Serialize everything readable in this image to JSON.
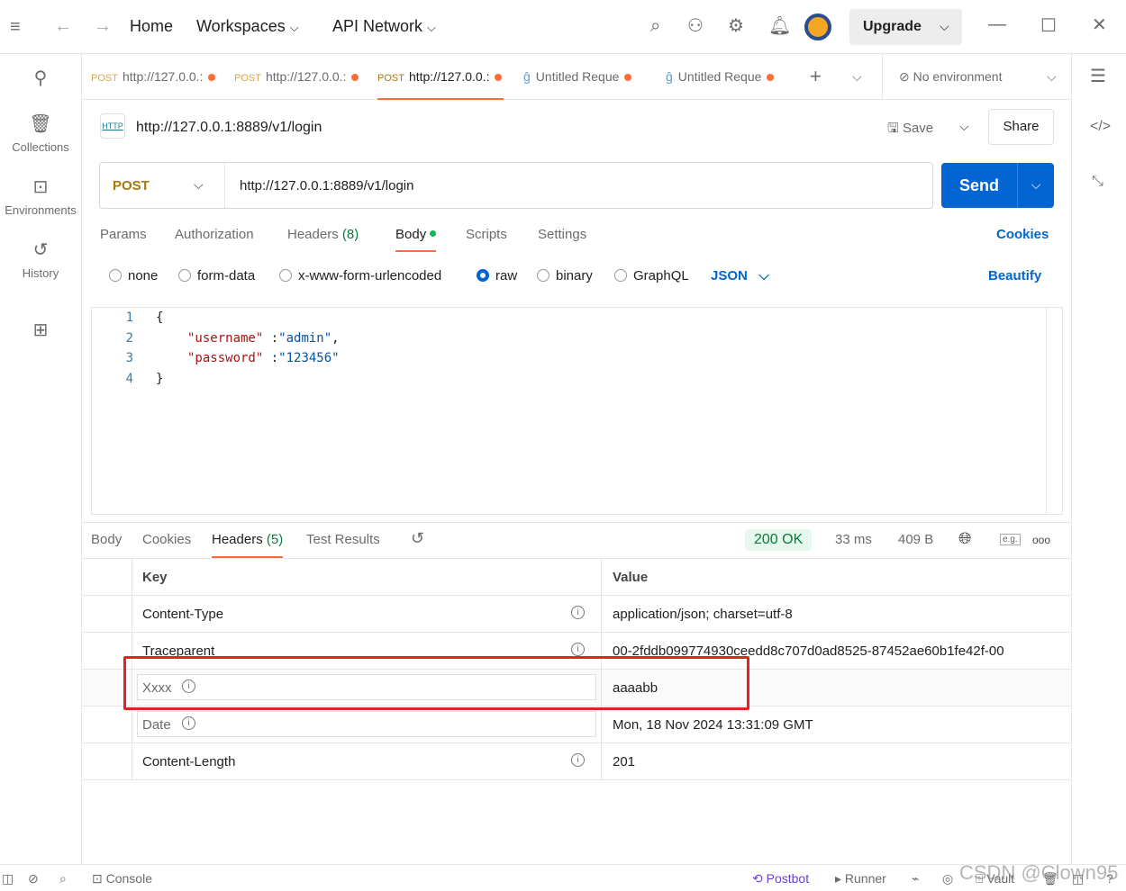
{
  "topbar": {
    "home": "Home",
    "workspaces": "Workspaces",
    "api_network": "API Network",
    "upgrade": "Upgrade"
  },
  "sidebar": {
    "items": [
      {
        "label": "Collections",
        "icon": "trash-bin-icon"
      },
      {
        "label": "Environments",
        "icon": "environment-icon"
      },
      {
        "label": "History",
        "icon": "history-icon"
      }
    ]
  },
  "tabs": [
    {
      "method": "POST",
      "label": "http://127.0.0.:"
    },
    {
      "method": "POST",
      "label": "http://127.0.0.:"
    },
    {
      "method": "POST",
      "label": "http://127.0.0.:"
    },
    {
      "method": "",
      "label": "Untitled Reque"
    },
    {
      "method": "",
      "label": "Untitled Reque"
    }
  ],
  "environment": "No environment",
  "request": {
    "title": "http://127.0.0.1:8889/v1/login",
    "save": "Save",
    "share": "Share",
    "method": "POST",
    "url": "http://127.0.0.1:8889/v1/login",
    "send": "Send"
  },
  "request_tabs": {
    "params": "Params",
    "authorization": "Authorization",
    "headers": "Headers",
    "headers_count": "(8)",
    "body": "Body",
    "scripts": "Scripts",
    "settings": "Settings",
    "cookies": "Cookies"
  },
  "body_types": {
    "none": "none",
    "form_data": "form-data",
    "urlencoded": "x-www-form-urlencoded",
    "raw": "raw",
    "binary": "binary",
    "graphql": "GraphQL",
    "format": "JSON",
    "beautify": "Beautify",
    "selected": "raw"
  },
  "editor": {
    "line_numbers": [
      "1",
      "2",
      "3",
      "4"
    ],
    "open": "{",
    "k1": "\"username\"",
    "v1": "\"admin\"",
    "k2": "\"password\"",
    "v2": "\"123456\"",
    "close": "}"
  },
  "response_tabs": {
    "body": "Body",
    "cookies": "Cookies",
    "headers": "Headers",
    "headers_count": "(5)",
    "test_results": "Test Results"
  },
  "response_meta": {
    "status": "200 OK",
    "time": "33 ms",
    "size": "409 B",
    "status_color": "#0b7a3e"
  },
  "headers_table": {
    "columns": [
      "Key",
      "Value"
    ],
    "rows": [
      {
        "key": "Content-Type",
        "value": "application/json; charset=utf-8"
      },
      {
        "key": "Traceparent",
        "value": "00-2fddb099774930ceedd8c707d0ad8525-87452ae60b1fe42f-00"
      },
      {
        "key": "Xxxx",
        "value": "aaaabb"
      },
      {
        "key": "Date",
        "value": "Mon, 18 Nov 2024 13:31:09 GMT"
      },
      {
        "key": "Content-Length",
        "value": "201"
      }
    ]
  },
  "statusbar": {
    "console": "Console",
    "postbot": "Postbot",
    "runner": "Runner",
    "vault": "Vault"
  },
  "watermark": "CSDN @Clown95",
  "colors": {
    "accent": "#ff6c37",
    "send": "#0265d2",
    "highlight_box": "#e8221b"
  }
}
